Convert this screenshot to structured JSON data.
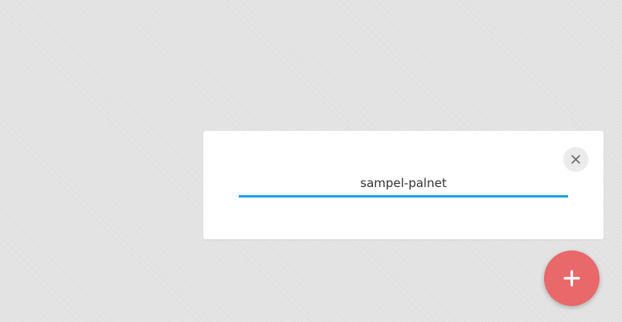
{
  "dialog": {
    "name_value": "sampel-palnet",
    "close_icon": "close-icon",
    "underline_color": "#1ea2e0"
  },
  "fab": {
    "icon": "plus-icon",
    "color": "#e9686a"
  }
}
